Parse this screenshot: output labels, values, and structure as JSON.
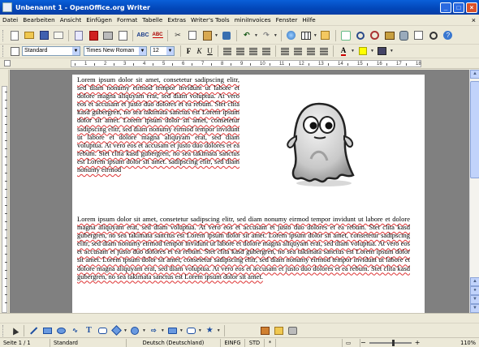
{
  "window": {
    "title": "Unbenannt 1 - OpenOffice.org Writer",
    "minimize": "_",
    "maximize": "□",
    "close": "×"
  },
  "menu": {
    "items": [
      "Datei",
      "Bearbeiten",
      "Ansicht",
      "Einfügen",
      "Format",
      "Tabelle",
      "Extras",
      "Writer's Tools",
      "miniInvoices",
      "Fenster",
      "Hilfe"
    ],
    "close_doc": "×"
  },
  "formatting": {
    "style": "Standard",
    "font": "Times New Roman",
    "size": "12",
    "bold": "F",
    "italic": "K",
    "underline": "U",
    "font_color": "A"
  },
  "ruler": {
    "numbers": [
      "1",
      "2",
      "3",
      "4",
      "5",
      "6",
      "7",
      "8",
      "9",
      "10",
      "11",
      "12",
      "13",
      "14",
      "15",
      "16",
      "17",
      "18"
    ]
  },
  "document": {
    "paragraph_1": "Lorem ipsum dolor sit amet, consetetur sadipscing elitr, sed diam nonumy eirmod tempor invidunt ut labore et dolore magna aliquyam erat, sed diam voluptua. At vero eos et accusam et justo duo dolores et ea rebum. Stet clita kasd gubergren, no sea takimata sanctus est Lorem ipsum dolor sit amet. Lorem ipsum dolor sit amet, consetetur sadipscing elitr, sed diam nonumy eirmod tempor invidunt ut labore et dolore magna aliquyam erat, sed diam voluptua. At vero eos et accusam et justo duo dolores et ea rebum. Stet clita kasd gubergren, no sea takimata sanctus est Lorem ipsum dolor sit amet. sadipscing elitr, sed diam nonumy eirmod",
    "paragraph_2": "Lorem ipsum dolor sit amet, consetetur sadipscing elitr, sed diam nonumy eirmod tempor invidunt ut labore et dolore magna aliquyam erat, sed diam voluptua. At vero eos et accusam et justo duo dolores et ea rebum. Stet clita kasd gubergren, no sea takimata sanctus est Lorem ipsum dolor sit amet. Lorem ipsum dolor sit amet, consetetur sadipscing elitr, sed diam nonumy eirmod tempor invidunt ut labore et dolore magna aliquyam erat, sed diam voluptua. At vero eos et accusam et justo duo dolores et ea rebum. Stet clita kasd gubergren, no sea takimata sanctus est Lorem ipsum dolor sit amet. Lorem ipsum dolor sit amet, consetetur sadipscing elitr, sed diam nonumy eirmod tempor invidunt ut labore et dolore magna aliquyam erat, sed diam voluptua. At vero eos et accusam et justo duo dolores et ea rebum. Stet clita kasd gubergren, no sea takimata sanctus est Lorem ipsum dolor sit amet."
  },
  "status": {
    "page": "Seite 1 / 1",
    "page_style": "Standard",
    "language": "Deutsch (Deutschland)",
    "insert_mode": "EINFG",
    "selection_mode": "STD",
    "modified": "*",
    "zoom": "110%"
  },
  "colors": {
    "titlebar": "#0a5fd8",
    "chrome": "#ece9d8",
    "doc_background": "#808080"
  }
}
